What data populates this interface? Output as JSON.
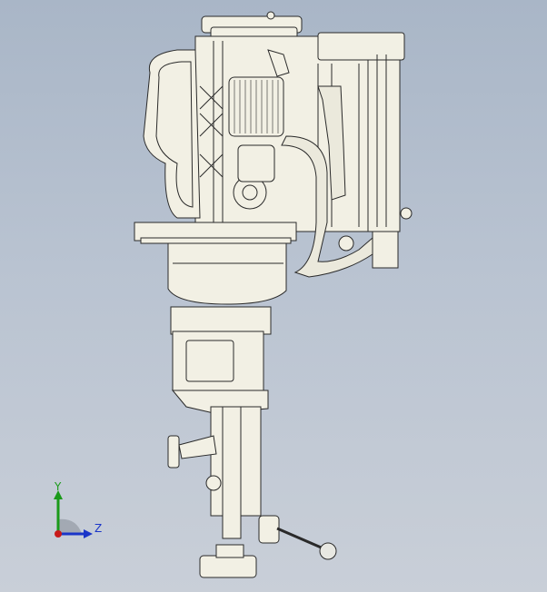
{
  "viewport": {
    "background_top": "#a9b6c7",
    "background_bottom": "#c9cfd8",
    "model_fill": "#f2f0e4",
    "model_stroke": "#2a2a2a",
    "pipe_fill": "#ebe9dc"
  },
  "triad": {
    "y_label": "Y",
    "z_label": "Z",
    "y_color": "#1a9a1a",
    "z_color": "#1a35c8",
    "x_color": "#c81a1a"
  }
}
